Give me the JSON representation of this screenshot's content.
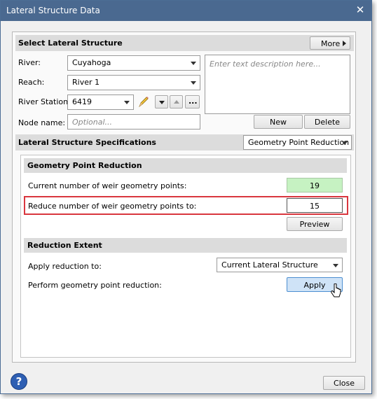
{
  "window": {
    "title": "Lateral Structure Data"
  },
  "select_section": {
    "title": "Select Lateral Structure",
    "more_label": "More",
    "river_label": "River:",
    "river_value": "Cuyahoga",
    "reach_label": "Reach:",
    "reach_value": "River 1",
    "station_label": "River Station:",
    "station_value": "6419",
    "node_label": "Node name:",
    "node_placeholder": "Optional...",
    "description_placeholder": "Enter text description here...",
    "new_label": "New",
    "delete_label": "Delete"
  },
  "specs_section": {
    "title": "Lateral Structure Specifications",
    "mode_value": "Geometry Point Reduction"
  },
  "gpr": {
    "title": "Geometry Point Reduction",
    "current_label": "Current number of weir geometry points:",
    "current_value": "19",
    "reduce_label": "Reduce number of weir geometry points to:",
    "reduce_value": "15",
    "preview_label": "Preview"
  },
  "extent": {
    "title": "Reduction Extent",
    "apply_to_label": "Apply reduction to:",
    "apply_to_value": "Current Lateral Structure",
    "perform_label": "Perform geometry point reduction:",
    "apply_label": "Apply"
  },
  "footer": {
    "help_glyph": "?",
    "close_label": "Close"
  },
  "colors": {
    "title_bar": "#4a6990",
    "current_value_bg": "#c6f2c2",
    "highlight_border": "#d9363e",
    "apply_bg": "#cfe3f7"
  }
}
